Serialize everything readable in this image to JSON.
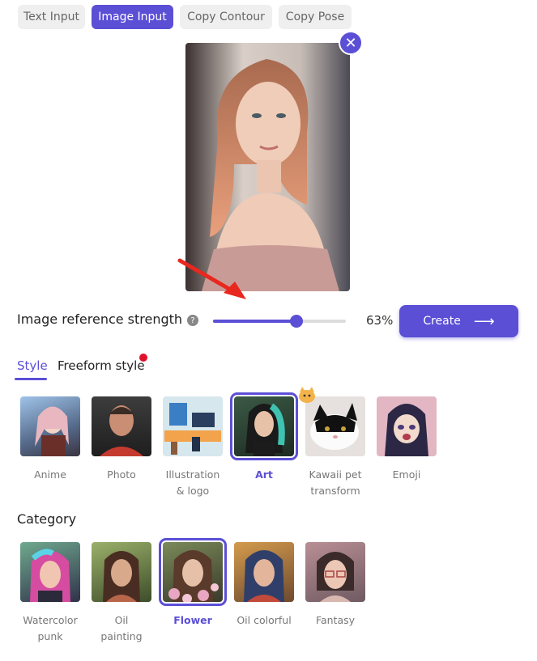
{
  "tabs": [
    {
      "label": "Text Input",
      "active": false
    },
    {
      "label": "Image Input",
      "active": true
    },
    {
      "label": "Copy Contour",
      "active": false
    },
    {
      "label": "Copy Pose",
      "active": false
    }
  ],
  "preview": {
    "close_icon": "✕"
  },
  "strength": {
    "label": "Image reference strength",
    "help_icon": "?",
    "value_percent": 63,
    "value_text": "63%"
  },
  "create_button": {
    "label": "Create",
    "arrow": "⟶"
  },
  "style_tabs": [
    {
      "label": "Style",
      "active": true
    },
    {
      "label": "Freeform style",
      "active": false,
      "has_notification_dot": true
    }
  ],
  "styles": [
    {
      "label_line1": "Anime",
      "label_line2": "",
      "selected": false
    },
    {
      "label_line1": "Photo",
      "label_line2": "",
      "selected": false
    },
    {
      "label_line1": "Illustration",
      "label_line2": "& logo",
      "selected": false
    },
    {
      "label_line1": "Art",
      "label_line2": "",
      "selected": true
    },
    {
      "label_line1": "Kawaii pet",
      "label_line2": "transform",
      "selected": false
    },
    {
      "label_line1": "Emoji",
      "label_line2": "",
      "selected": false
    }
  ],
  "category": {
    "title": "Category",
    "items": [
      {
        "label_line1": "Watercolor",
        "label_line2": "punk",
        "selected": false
      },
      {
        "label_line1": "Oil",
        "label_line2": "painting",
        "selected": false
      },
      {
        "label_line1": "Flower",
        "label_line2": "",
        "selected": true
      },
      {
        "label_line1": "Oil colorful",
        "label_line2": "",
        "selected": false
      },
      {
        "label_line1": "Fantasy",
        "label_line2": "",
        "selected": false
      }
    ]
  },
  "colors": {
    "accent": "#5b4fd6",
    "notification": "#e0112b",
    "annotation_arrow": "#e8271e"
  }
}
